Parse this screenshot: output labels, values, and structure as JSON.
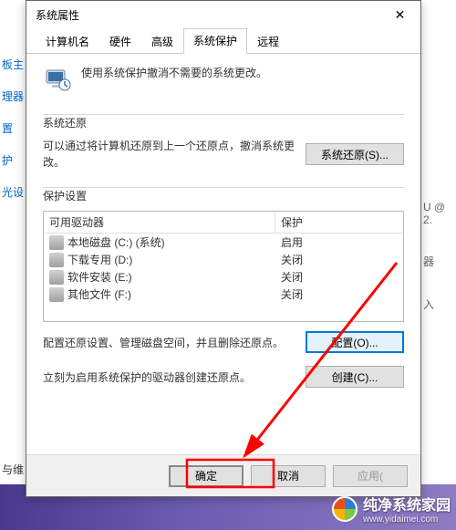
{
  "bg": {
    "left_items": [
      "板主",
      "理器",
      "置",
      "护",
      "光设"
    ],
    "right_items": [
      "U @ 2.",
      "器",
      "入"
    ],
    "bottom_left": "与维"
  },
  "dialog": {
    "title": "系统属性",
    "close_glyph": "✕",
    "tabs": [
      "计算机名",
      "硬件",
      "高级",
      "系统保护",
      "远程"
    ],
    "intro": "使用系统保护撤消不需要的系统更改。",
    "section_restore": {
      "title": "系统还原",
      "desc": "可以通过将计算机还原到上一个还原点，撤消系统更改。",
      "button": "系统还原(S)..."
    },
    "section_settings": {
      "title": "保护设置",
      "header_drive": "可用驱动器",
      "header_status": "保护",
      "drives": [
        {
          "name": "本地磁盘 (C:) (系统)",
          "status": "启用"
        },
        {
          "name": "下载专用 (D:)",
          "status": "关闭"
        },
        {
          "name": "软件安装 (E:)",
          "status": "关闭"
        },
        {
          "name": "其他文件 (F:)",
          "status": "关闭"
        }
      ],
      "config_desc": "配置还原设置、管理磁盘空间，并且删除还原点。",
      "config_btn": "配置(O)...",
      "create_desc": "立刻为启用系统保护的驱动器创建还原点。",
      "create_btn": "创建(C)..."
    },
    "footer": {
      "ok": "确定",
      "cancel": "取消",
      "apply": "应用("
    }
  },
  "watermark": {
    "brand": "纯净系统家园",
    "url": "www.yidaimei.com"
  }
}
